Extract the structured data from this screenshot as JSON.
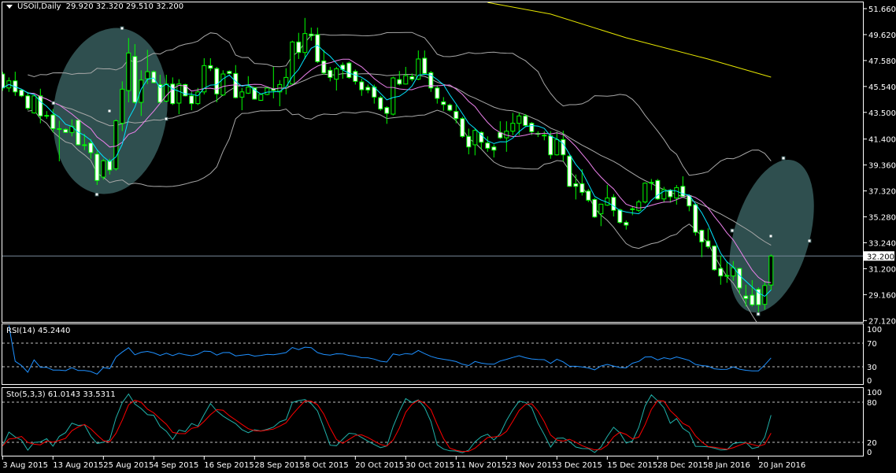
{
  "header": {
    "symbol_timeframe": "USOil,Daily",
    "ohlc": "29.920 32.320 29.510 32.200",
    "menu_icon": "triangle-down-icon"
  },
  "price_axis": {
    "ticks": [
      "51.660",
      "49.620",
      "47.580",
      "45.540",
      "43.500",
      "41.400",
      "39.360",
      "37.320",
      "35.280",
      "33.240",
      "31.200",
      "29.160",
      "27.120"
    ],
    "current_price": "32.200"
  },
  "rsi": {
    "label": "RSI(14) 45.2440",
    "period": 14,
    "levels": [
      70,
      30
    ],
    "axis_ticks": [
      "100",
      "70",
      "30",
      "0"
    ],
    "color": "#1e90ff"
  },
  "stochastic": {
    "label": "Sto(5,3,3) 61.0143 33.5311",
    "k": 5,
    "d": 3,
    "slowing": 3,
    "levels": [
      80,
      20
    ],
    "axis_ticks": [
      "100",
      "80",
      "20",
      "0"
    ],
    "k_color": "#20b2aa",
    "d_color": "#ff0000"
  },
  "colors": {
    "background": "#000000",
    "candle_outline": "#00ff00",
    "bull_body": "#000000",
    "bear_body": "#ffffff",
    "fast_ma": "#00e5ff",
    "slow_ma": "#ee82ee",
    "bollinger": "#a8a8a8",
    "ma200": "#e6e600",
    "ellipse": "#2f4f4f",
    "price_line": "#778899"
  },
  "chart_data": {
    "type": "candlestick",
    "title": "USOil,Daily",
    "ylim": [
      27.12,
      51.66
    ],
    "grid": false,
    "x_tick_labels": [
      "3 Aug 2015",
      "13 Aug 2015",
      "25 Aug 2015",
      "4 Sep 2015",
      "16 Sep 2015",
      "28 Sep 2015",
      "8 Oct 2015",
      "20 Oct 2015",
      "30 Oct 2015",
      "11 Nov 2015",
      "23 Nov 2015",
      "3 Dec 2015",
      "15 Dec 2015",
      "28 Dec 2015",
      "8 Jan 2016",
      "20 Jan 2016"
    ],
    "ohlc_format": [
      "open",
      "high",
      "low",
      "close"
    ],
    "candles": [
      [
        46.52,
        46.7,
        45.2,
        45.42
      ],
      [
        45.42,
        46.25,
        45.11,
        45.98
      ],
      [
        45.98,
        46.7,
        44.8,
        45.11
      ],
      [
        45.26,
        45.3,
        44.7,
        44.8
      ],
      [
        44.8,
        45.11,
        43.67,
        43.83
      ],
      [
        43.46,
        44.85,
        43.4,
        44.8
      ],
      [
        44.8,
        45.36,
        42.64,
        43.22
      ],
      [
        43.26,
        43.6,
        43.0,
        43.22
      ],
      [
        43.3,
        43.77,
        41.92,
        42.22
      ],
      [
        42.22,
        42.84,
        39.65,
        42.2
      ],
      [
        42.16,
        42.25,
        41.9,
        41.92
      ],
      [
        41.92,
        42.95,
        41.61,
        42.39
      ],
      [
        42.89,
        43.0,
        40.9,
        40.95
      ],
      [
        40.95,
        41.81,
        40.53,
        40.95
      ],
      [
        41.09,
        41.4,
        39.85,
        40.33
      ],
      [
        40.22,
        40.47,
        37.79,
        38.14
      ],
      [
        38.41,
        39.85,
        38.2,
        39.69
      ],
      [
        39.69,
        39.85,
        38.61,
        38.96
      ],
      [
        39.07,
        42.95,
        38.92,
        42.84
      ],
      [
        42.64,
        45.94,
        42.02,
        45.32
      ],
      [
        45.22,
        49.35,
        44.29,
        48.17
      ],
      [
        47.9,
        48.87,
        44.19,
        44.29
      ],
      [
        44.29,
        46.81,
        43.22,
        46.04
      ],
      [
        46.15,
        48.42,
        45.73,
        46.7
      ],
      [
        46.7,
        46.8,
        45.8,
        45.84
      ],
      [
        45.69,
        46.46,
        44.19,
        44.29
      ],
      [
        44.39,
        46.46,
        44.29,
        45.73
      ],
      [
        45.73,
        46.25,
        44.08,
        44.19
      ],
      [
        44.23,
        46.11,
        43.36,
        45.73
      ],
      [
        45.69,
        45.75,
        44.75,
        44.8
      ],
      [
        44.8,
        45.11,
        43.67,
        44.19
      ],
      [
        44.19,
        45.42,
        44.08,
        45.11
      ],
      [
        45.11,
        47.76,
        44.91,
        47.18
      ],
      [
        47.18,
        47.76,
        46.75,
        46.97
      ],
      [
        46.95,
        47.08,
        44.29,
        44.95
      ],
      [
        44.87,
        46.81,
        44.8,
        46.52
      ],
      [
        46.72,
        46.8,
        46.5,
        46.56
      ],
      [
        46.56,
        47.22,
        44.6,
        44.66
      ],
      [
        44.7,
        45.42,
        43.67,
        45.11
      ],
      [
        45.01,
        46.35,
        44.95,
        45.49
      ],
      [
        45.42,
        45.5,
        44.5,
        44.54
      ],
      [
        44.45,
        44.95,
        44.4,
        44.91
      ],
      [
        44.91,
        45.5,
        44.85,
        45.42
      ],
      [
        45.36,
        47.08,
        44.6,
        45.22
      ],
      [
        45.11,
        46.04,
        43.98,
        45.69
      ],
      [
        45.42,
        46.97,
        44.91,
        46.25
      ],
      [
        45.73,
        49.14,
        45.63,
        49.04
      ],
      [
        49.04,
        49.76,
        47.7,
        48.21
      ],
      [
        48.21,
        50.93,
        47.7,
        49.7
      ],
      [
        49.66,
        50.17,
        49.14,
        49.53
      ],
      [
        49.62,
        50.17,
        47.38,
        47.49
      ],
      [
        47.55,
        48.42,
        46.46,
        46.6
      ],
      [
        46.81,
        47.08,
        45.94,
        46.25
      ],
      [
        46.11,
        47.08,
        45.22,
        46.93
      ],
      [
        47.22,
        47.43,
        46.15,
        46.87
      ],
      [
        47.38,
        47.49,
        46.15,
        46.25
      ],
      [
        46.72,
        46.87,
        45.69,
        45.94
      ],
      [
        45.9,
        46.15,
        44.8,
        45.28
      ],
      [
        45.47,
        45.69,
        45.01,
        45.26
      ],
      [
        45.49,
        45.69,
        44.19,
        44.7
      ],
      [
        44.66,
        44.8,
        43.63,
        43.77
      ],
      [
        43.88,
        43.98,
        42.6,
        43.42
      ],
      [
        43.36,
        46.31,
        43.26,
        46.21
      ],
      [
        46.08,
        46.76,
        45.63,
        45.73
      ],
      [
        45.73,
        47.08,
        45.69,
        46.39
      ],
      [
        46.31,
        46.56,
        45.94,
        46.11
      ],
      [
        46.11,
        48.37,
        46.04,
        47.7
      ],
      [
        47.76,
        48.37,
        46.46,
        46.56
      ],
      [
        46.62,
        46.76,
        45.11,
        45.42
      ],
      [
        45.42,
        45.63,
        44.19,
        44.6
      ],
      [
        44.33,
        44.7,
        43.63,
        44.12
      ],
      [
        44.08,
        44.19,
        43.57,
        43.67
      ],
      [
        43.57,
        44.08,
        42.64,
        43.01
      ],
      [
        43.01,
        43.15,
        41.5,
        41.61
      ],
      [
        41.61,
        42.22,
        40.2,
        40.78
      ],
      [
        40.95,
        42.22,
        40.12,
        42.08
      ],
      [
        41.92,
        42.02,
        40.61,
        41.15
      ],
      [
        41.09,
        41.61,
        40.4,
        40.68
      ],
      [
        40.78,
        40.98,
        39.95,
        40.53
      ],
      [
        41.92,
        42.8,
        41.4,
        41.5
      ],
      [
        41.5,
        42.8,
        40.4,
        42.02
      ],
      [
        42.02,
        43.46,
        41.71,
        42.64
      ],
      [
        42.64,
        43.46,
        41.71,
        43.22
      ],
      [
        43.22,
        43.36,
        42.39,
        42.47
      ],
      [
        42.64,
        42.74,
        41.71,
        41.98
      ],
      [
        41.85,
        42.02,
        41.56,
        41.81
      ],
      [
        41.71,
        42.02,
        41.3,
        41.71
      ],
      [
        41.65,
        42.02,
        39.85,
        40.16
      ],
      [
        40.16,
        41.98,
        40.1,
        41.36
      ],
      [
        41.36,
        42.06,
        39.65,
        40.16
      ],
      [
        40.06,
        40.16,
        37.64,
        37.68
      ],
      [
        37.89,
        38.61,
        36.65,
        37.68
      ],
      [
        37.89,
        39.03,
        36.96,
        37.21
      ],
      [
        37.31,
        37.48,
        36.44,
        36.59
      ],
      [
        36.65,
        36.76,
        35.2,
        35.27
      ],
      [
        35.52,
        36.28,
        34.55,
        36.28
      ],
      [
        36.2,
        37.79,
        36.14,
        36.76
      ],
      [
        36.82,
        37.07,
        35.31,
        35.79
      ],
      [
        35.83,
        35.93,
        34.75,
        34.84
      ],
      [
        34.84,
        35.0,
        34.28,
        34.63
      ],
      [
        35.91,
        36.14,
        35.41,
        35.91
      ],
      [
        35.79,
        36.61,
        35.66,
        36.45
      ],
      [
        36.45,
        37.99,
        36.34,
        37.93
      ],
      [
        37.99,
        38.26,
        37.38,
        37.99
      ],
      [
        38.14,
        38.26,
        36.61,
        36.69
      ],
      [
        36.69,
        37.64,
        36.4,
        37.43
      ],
      [
        37.37,
        37.48,
        36.4,
        36.86
      ],
      [
        36.76,
        37.79,
        36.24,
        37.58
      ],
      [
        37.68,
        38.47,
        36.76,
        36.9
      ],
      [
        36.96,
        37.06,
        35.72,
        36.14
      ],
      [
        36.24,
        36.34,
        33.8,
        34.07
      ],
      [
        34.22,
        34.28,
        32.11,
        33.31
      ],
      [
        33.39,
        34.38,
        32.78,
        32.94
      ],
      [
        32.98,
        33.04,
        31.04,
        31.12
      ],
      [
        31.22,
        32.22,
        29.94,
        30.63
      ],
      [
        30.67,
        31.8,
        30.09,
        30.67
      ],
      [
        30.63,
        31.8,
        30.25,
        31.28
      ],
      [
        31.22,
        31.28,
        29.22,
        29.68
      ],
      [
        29.06,
        29.94,
        28.23,
        28.85
      ],
      [
        29.12,
        30.3,
        28.23,
        28.36
      ],
      [
        29.59,
        29.74,
        27.61,
        28.36
      ],
      [
        28.4,
        30.25,
        27.98,
        29.88
      ],
      [
        29.92,
        32.32,
        29.51,
        32.2
      ]
    ],
    "indicators": {
      "fast_ma_period": 5,
      "slow_ma_period": 10,
      "bollinger": {
        "period": 20,
        "deviation": 2
      },
      "ma200_points": [
        [
          77,
          52.15
        ],
        [
          87,
          51.23
        ],
        [
          99,
          49.37
        ],
        [
          112,
          47.7
        ],
        [
          122,
          46.27
        ]
      ]
    },
    "current_price": 32.2
  }
}
